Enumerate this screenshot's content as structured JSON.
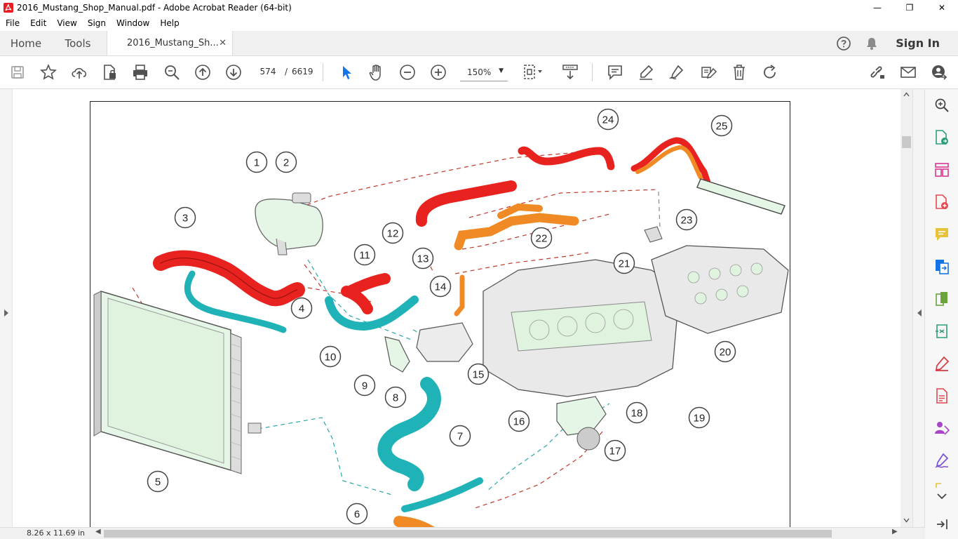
{
  "window": {
    "title": "2016_Mustang_Shop_Manual.pdf - Adobe Acrobat Reader (64-bit)",
    "minimize": "—",
    "maximize": "❐",
    "close": "✕"
  },
  "menu": [
    "File",
    "Edit",
    "View",
    "Sign",
    "Window",
    "Help"
  ],
  "tabs": {
    "home": "Home",
    "tools": "Tools",
    "doc": "2016_Mustang_Sh...",
    "doc_close": "✕",
    "sign_in": "Sign In"
  },
  "toolbar": {
    "current_page": "574",
    "separator": "/",
    "total_pages": "6619",
    "zoom": "150%"
  },
  "status": {
    "page_size": "8.26 x 11.69 in"
  },
  "diagram": {
    "callouts": [
      "1",
      "2",
      "3",
      "4",
      "5",
      "6",
      "7",
      "8",
      "9",
      "10",
      "11",
      "12",
      "13",
      "14",
      "15",
      "16",
      "17",
      "18",
      "19",
      "20",
      "21",
      "22",
      "23",
      "24",
      "25"
    ]
  },
  "colors": {
    "accent_blue": "#1473e6",
    "hose_red": "#e8231f",
    "hose_teal": "#1fb3b8",
    "hose_orange": "#f08a24",
    "component_green": "#e4f6e4",
    "right_panel_icons": [
      "#1473e6",
      "#2d9d78",
      "#d83790",
      "#e34850",
      "#e8c23a",
      "#1473e6",
      "#6ba33d",
      "#2d9d78",
      "#d7373f",
      "#e34850",
      "#a945c8",
      "#7a52d8"
    ]
  }
}
